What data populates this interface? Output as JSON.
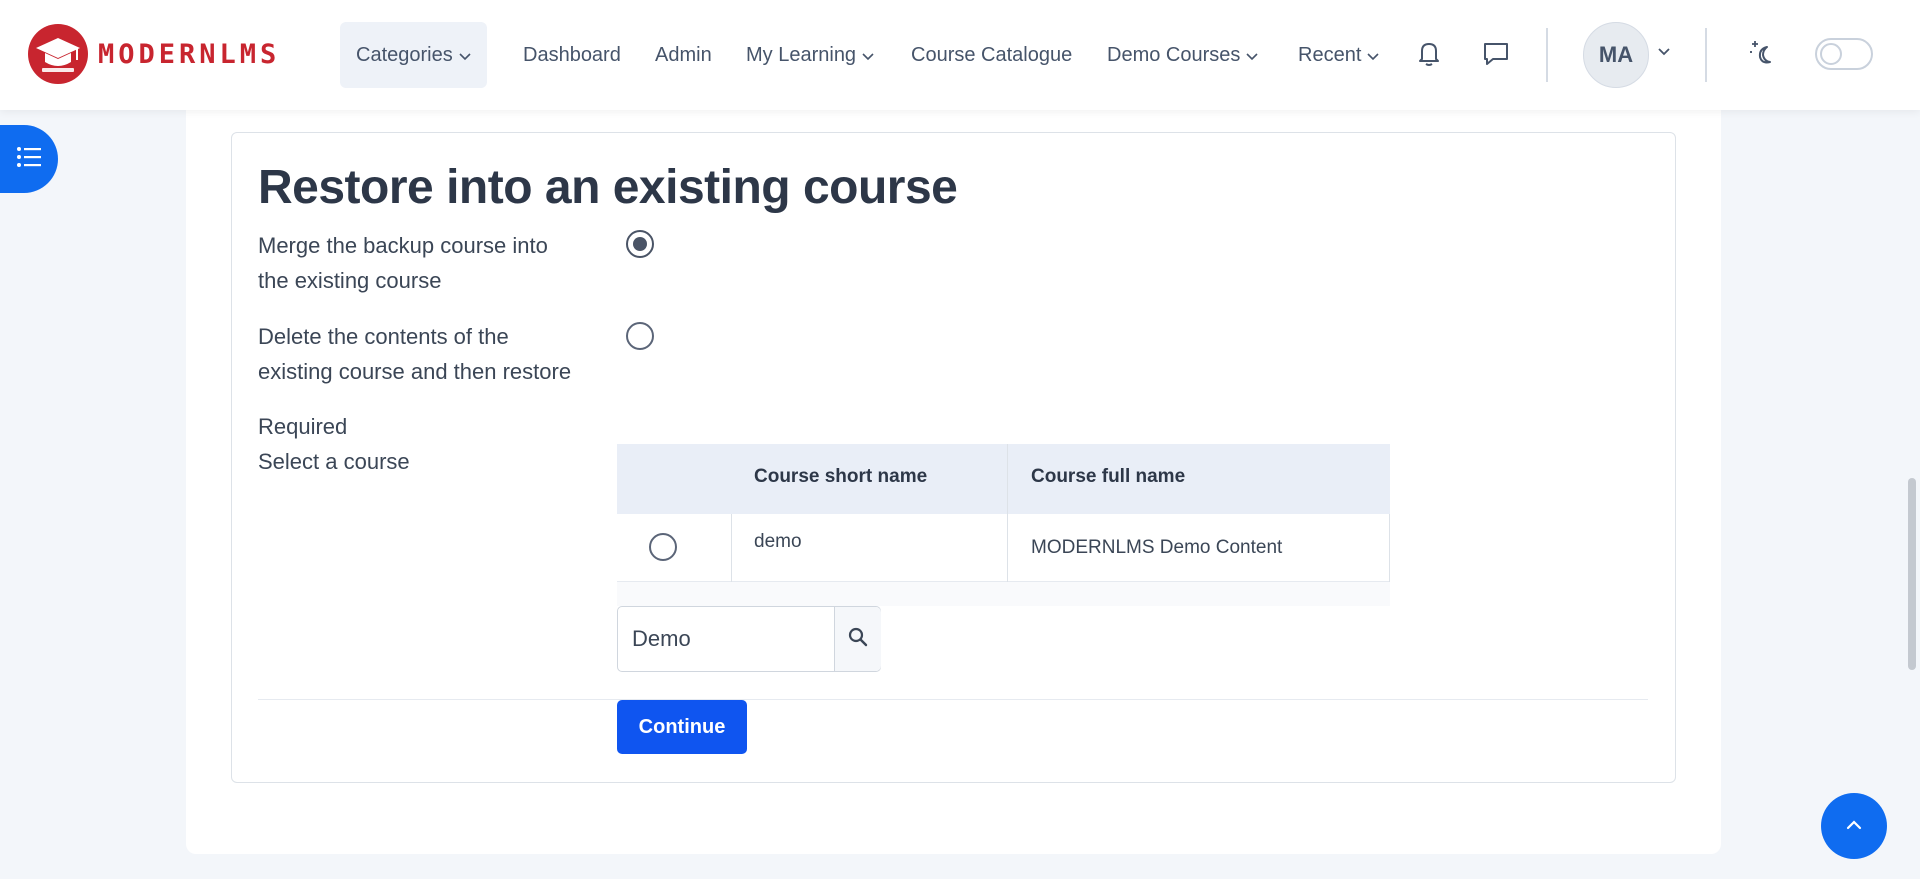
{
  "brand": {
    "logo_text": "MODERNLMS",
    "logo_subtext": "MODERNLMS"
  },
  "nav": {
    "categories": "Categories",
    "dashboard": "Dashboard",
    "admin": "Admin",
    "my_learning": "My Learning",
    "course_catalogue": "Course Catalogue",
    "demo_courses": "Demo Courses",
    "recent": "Recent",
    "avatar_initials": "MA"
  },
  "form": {
    "heading": "Restore into an existing course",
    "option_merge_line1": "Merge the backup course into",
    "option_merge_line2": "the existing course",
    "option_delete_line1": "Delete the contents of the",
    "option_delete_line2": "existing course and then restore",
    "required": "Required",
    "select_course": "Select a course",
    "table": {
      "headers": [
        "Course short name",
        "Course full name"
      ],
      "rows": [
        {
          "short_name": "demo",
          "full_name": "MODERNLMS Demo Content"
        }
      ]
    },
    "search_value": "Demo",
    "continue": "Continue"
  },
  "colors": {
    "primary": "#0f55f0",
    "brand_red": "#c8252f",
    "drawer_blue": "#0f6cf0"
  },
  "icons": [
    "graduation-cap-icon",
    "chevron-down-icon",
    "bell-icon",
    "chat-icon",
    "moon-stars-icon",
    "list-icon",
    "search-icon",
    "chevron-up-icon"
  ]
}
